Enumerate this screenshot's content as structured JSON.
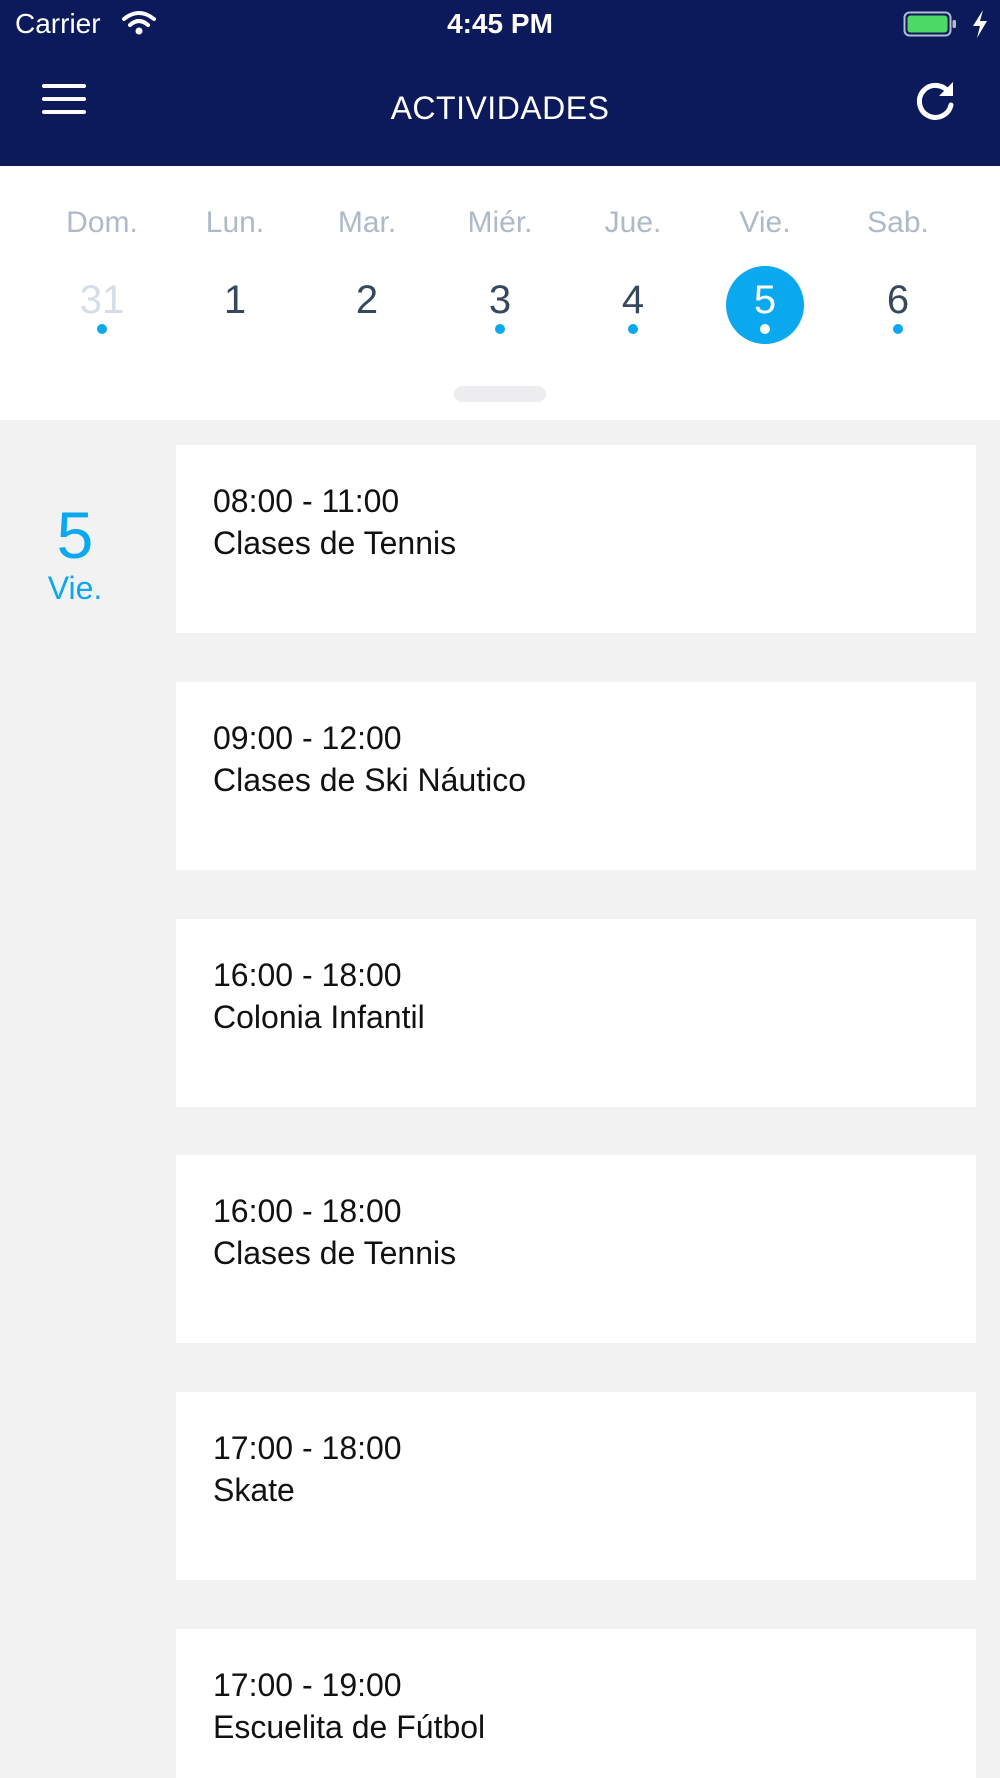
{
  "status_bar": {
    "carrier": "Carrier",
    "time": "4:45 PM",
    "icons": [
      "wifi-icon",
      "battery-icon",
      "charging-bolt-icon"
    ]
  },
  "nav_bar": {
    "title": "ACTIVIDADES",
    "left_icon": "hamburger-menu-icon",
    "right_icon": "refresh-icon",
    "background_color": "#0c1a5b"
  },
  "week": {
    "days": [
      {
        "name": "Dom.",
        "number": "31",
        "has_events": true,
        "selected": false,
        "muted": true
      },
      {
        "name": "Lun.",
        "number": "1",
        "has_events": false,
        "selected": false,
        "muted": false
      },
      {
        "name": "Mar.",
        "number": "2",
        "has_events": false,
        "selected": false,
        "muted": false
      },
      {
        "name": "Miér.",
        "number": "3",
        "has_events": true,
        "selected": false,
        "muted": false
      },
      {
        "name": "Jue.",
        "number": "4",
        "has_events": true,
        "selected": false,
        "muted": false
      },
      {
        "name": "Vie.",
        "number": "5",
        "has_events": true,
        "selected": true,
        "muted": false
      },
      {
        "name": "Sab.",
        "number": "6",
        "has_events": true,
        "selected": false,
        "muted": false
      }
    ],
    "accent_color": "#0aa8ee"
  },
  "selected_date": {
    "number": "5",
    "day": "Vie."
  },
  "events": [
    {
      "time": "08:00 - 11:00",
      "title": "Clases de Tennis"
    },
    {
      "time": "09:00 - 12:00",
      "title": "Clases de Ski Náutico"
    },
    {
      "time": "16:00 - 18:00",
      "title": "Colonia Infantil"
    },
    {
      "time": "16:00 - 18:00",
      "title": "Clases de Tennis"
    },
    {
      "time": "17:00 - 18:00",
      "title": "Skate"
    },
    {
      "time": "17:00 - 19:00",
      "title": "Escuelita de Fútbol"
    }
  ]
}
